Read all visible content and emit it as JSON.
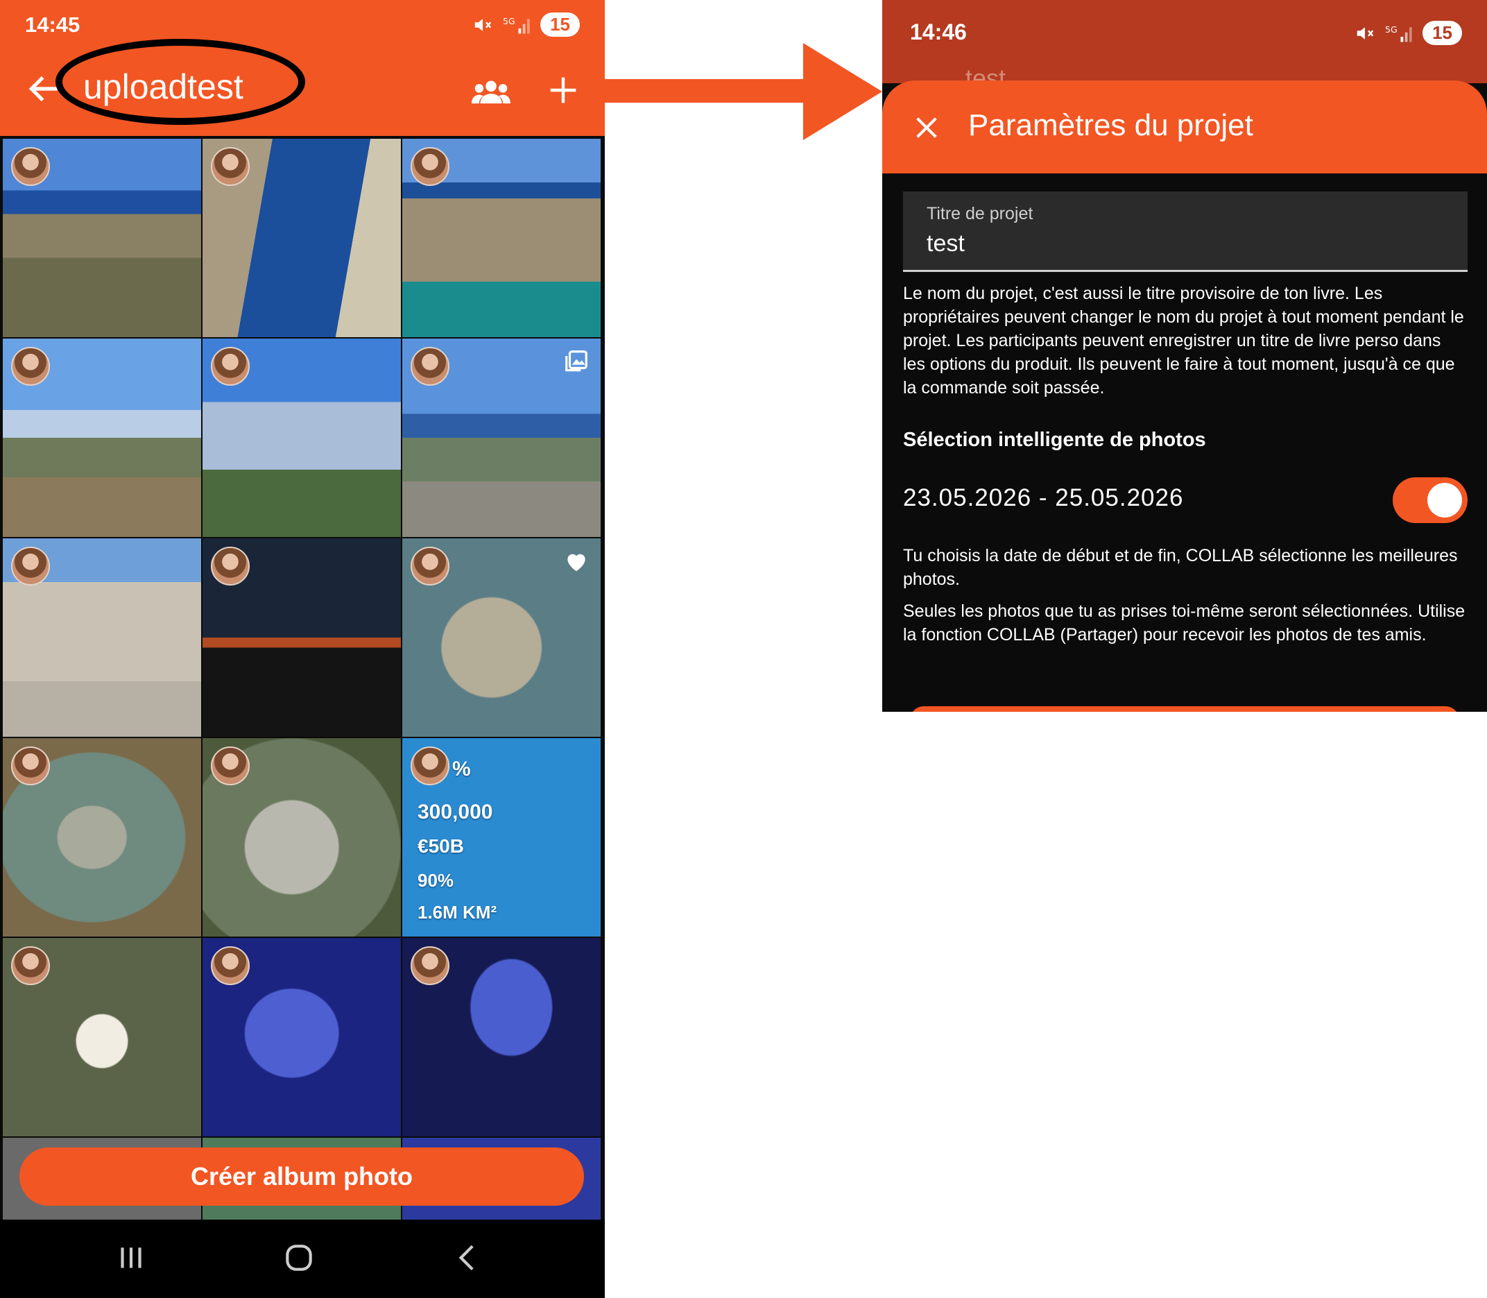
{
  "left_screen": {
    "status_time": "14:45",
    "battery": "15",
    "title": "uploadtest",
    "cta_label": "Créer album photo",
    "tile_texts": [
      "%",
      "300,000",
      "€50B",
      "90%",
      "1.6M KM²"
    ]
  },
  "right_screen": {
    "status_time": "14:46",
    "battery": "15",
    "peek_title": "test",
    "sheet_title": "Paramètres du projet",
    "field_label": "Titre de projet",
    "field_value": "test",
    "description": "Le nom du projet, c'est aussi le titre provisoire de ton livre. Les propriétaires peuvent changer le nom du projet à tout moment pendant le projet. Les participants peuvent enregistrer un titre de livre perso dans les options du produit. Ils peuvent le faire à tout moment, jusqu'à ce que la commande soit passée.",
    "section_title": "Sélection intelligente de photos",
    "date_range": "23.05.2026 - 25.05.2026",
    "toggle_on": true,
    "note1": "Tu choisis la date de début et de fin, COLLAB sélectionne les meilleures photos.",
    "note2": "Seules les photos que tu as prises toi-même seront sélectionnées. Utilise la fonction COLLAB (Partager) pour recevoir les photos de tes amis."
  },
  "colors": {
    "accent": "#f25623",
    "status_bar_right": "#b53a20",
    "background_dark": "#0b0b0b",
    "field_bg": "#2b2b2b"
  },
  "icons": [
    "back-arrow-icon",
    "people-icon",
    "plus-icon",
    "gallery-icon",
    "heart-icon",
    "close-icon",
    "recents-icon",
    "home-icon",
    "back-nav-icon",
    "mute-icon",
    "signal-icon",
    "screenshot-icon",
    "mail-icon"
  ]
}
